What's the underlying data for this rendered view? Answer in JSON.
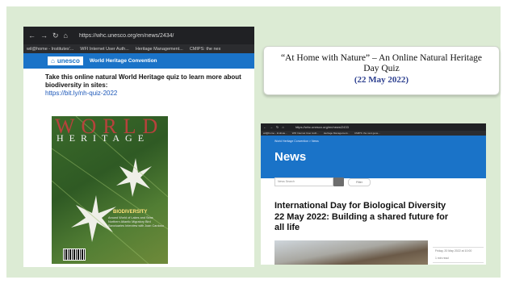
{
  "left_browser": {
    "url": "https://whc.unesco.org/en/news/2434/",
    "bookmarks": [
      "wil@home - Institutes'...",
      "WFI Internet User Auth...",
      "Heritage Management...",
      "CMIPS: the nex"
    ],
    "brand": "unesco",
    "brand_subtitle": "World Heritage Convention",
    "quiz_text": "Take this online natural World Heritage quiz to learn more about biodiversity in sites:",
    "quiz_link": "https://bit.ly/nh-quiz-2022",
    "cover": {
      "title_line1": "WORLD",
      "title_line2": "HERITAGE",
      "feature": "BIODIVERSITY",
      "fine_print": "Around World of Lakes and Seas Northern Atlantic Migratory Bird Sanctuaries Interview with Joan Cardoso"
    }
  },
  "title_card": {
    "line1": "“At Home with Nature” – An Online Natural Heritage",
    "line2": "Day Quiz",
    "date": "(22 May 2022)"
  },
  "right_browser": {
    "url": "https://whc.unesco.org/en/news/2433",
    "bookmarks": [
      "wil@home - Institute...",
      "WFI Internet User Auth...",
      "Heritage Management...",
      "CMIPS: the next gene..."
    ],
    "breadcrumb": "World Heritage Convention > News",
    "heading": "News",
    "search_placeholder": "News Search",
    "filter_label": "Filter",
    "article_title": "International Day for Biological Diversity 22 May 2022: Building a shared future for all life",
    "date_text": "Friday, 20 May 2022 at 10:00",
    "read_time": "1 min read"
  },
  "colors": {
    "slide_bg": "#dcebd4",
    "unesco_blue": "#1a73c8",
    "date_blue": "#2c3f8f"
  }
}
